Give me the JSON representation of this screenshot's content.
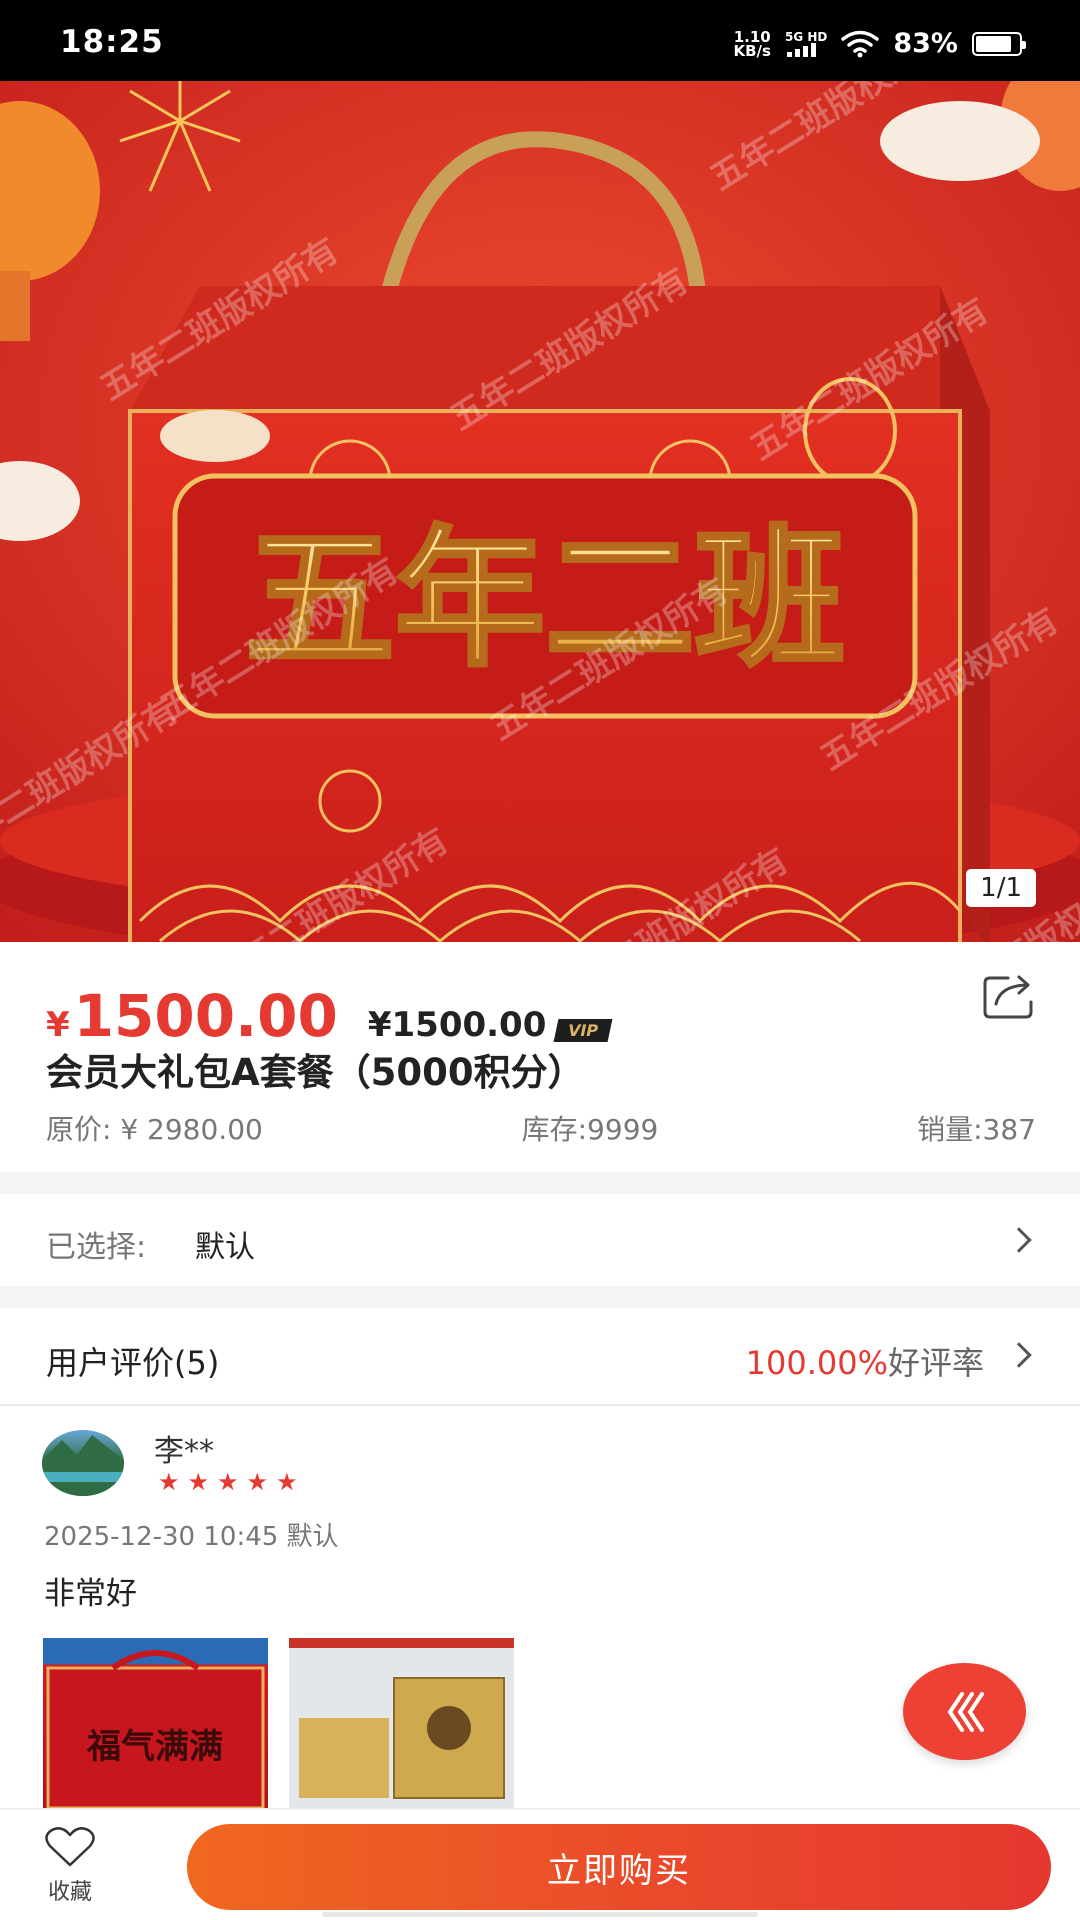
{
  "status_bar": {
    "time": "18:25",
    "net_speed_value": "1.10",
    "net_speed_unit": "KB/s",
    "network": "5G HD",
    "battery_pct": "83%",
    "battery_level": 0.83
  },
  "hero": {
    "box_title": "五年二班",
    "watermark": "五年二班版权所有",
    "image_counter": "1/1"
  },
  "product": {
    "currency": "¥",
    "price": "1500.00",
    "vip_price": "¥1500.00",
    "vip_badge": "VIP",
    "title": "会员大礼包A套餐（5000积分）",
    "original_price": "原价: ¥ 2980.00",
    "stock": "库存:9999",
    "sales": "销量:387"
  },
  "selection": {
    "label": "已选择:",
    "value": "默认"
  },
  "reviews": {
    "header_label": "用户评价(5)",
    "positive_rate": "100.00%",
    "positive_rate_label": "好评率",
    "items": [
      {
        "user": "李**",
        "rating": 5,
        "date_spec": "2025-12-30 10:45 默认",
        "text": "非常好",
        "thumb_text": "福气满满"
      }
    ]
  },
  "bottom_bar": {
    "favorite_label": "收藏",
    "buy_label": "立即购买"
  },
  "colors": {
    "accent": "#e53a32",
    "buy_gradient_start": "#f0681f",
    "buy_gradient_end": "#e4372f"
  }
}
